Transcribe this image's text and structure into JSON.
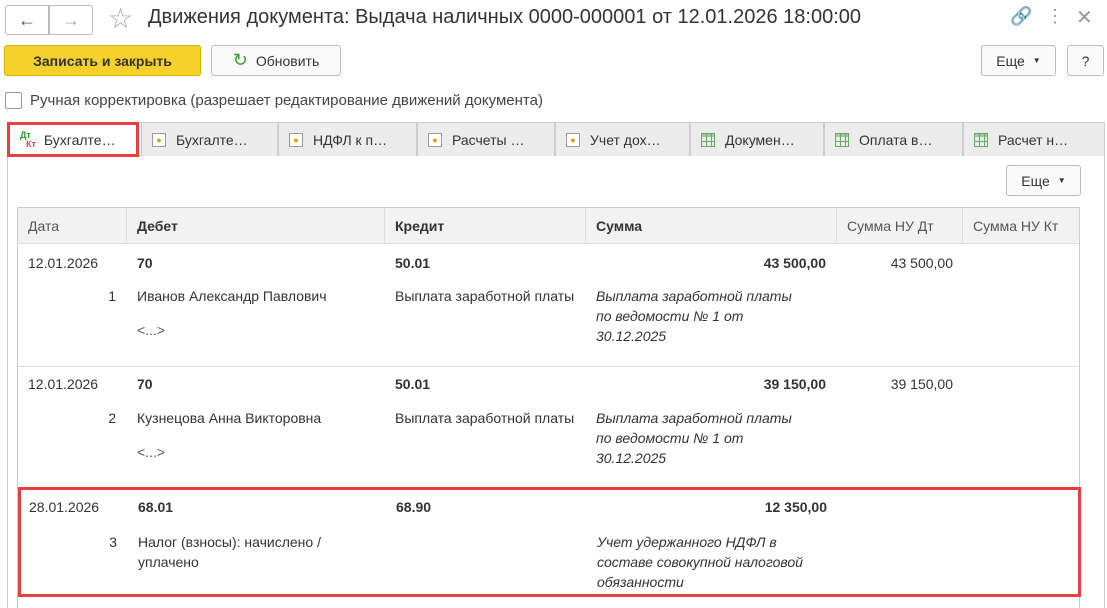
{
  "window": {
    "title": "Движения документа: Выдача наличных 0000-000001 от 12.01.2026 18:00:00"
  },
  "toolbar": {
    "save_close": "Записать и закрыть",
    "refresh": "Обновить",
    "more": "Еще",
    "help": "?"
  },
  "manual": {
    "label": "Ручная корректировка (разрешает редактирование движений документа)",
    "checked": false
  },
  "tabs": [
    {
      "label": "Бухгалте…",
      "icon": "dt-kt-icon",
      "active": true
    },
    {
      "label": "Бухгалте…",
      "icon": "register-coins-icon"
    },
    {
      "label": "НДФЛ к п…",
      "icon": "register-coins-icon"
    },
    {
      "label": "Расчеты …",
      "icon": "register-coins-icon"
    },
    {
      "label": "Учет дох…",
      "icon": "register-coins-icon"
    },
    {
      "label": "Докумен…",
      "icon": "table-grid-icon"
    },
    {
      "label": "Оплата в…",
      "icon": "table-grid-icon"
    },
    {
      "label": "Расчет н…",
      "icon": "table-grid-icon"
    }
  ],
  "panel": {
    "more": "Еще"
  },
  "table": {
    "headers": [
      "Дата",
      "Дебет",
      "Кредит",
      "Сумма",
      "Сумма НУ Дт",
      "Сумма НУ Кт"
    ],
    "rows": [
      {
        "date": "12.01.2026",
        "num": "1",
        "debit": "70",
        "debit_sub": "Иванов Александр Павлович",
        "debit_sub2": "<...>",
        "credit": "50.01",
        "credit_sub": "Выплата заработной платы",
        "sum": "43 500,00",
        "content": "Выплата заработной платы по ведомости № 1 от 30.12.2025",
        "nu_dt": "43 500,00"
      },
      {
        "date": "12.01.2026",
        "num": "2",
        "debit": "70",
        "debit_sub": "Кузнецова Анна Викторовна",
        "debit_sub2": "<...>",
        "credit": "50.01",
        "credit_sub": "Выплата заработной платы",
        "sum": "39 150,00",
        "content": "Выплата заработной платы по ведомости № 1 от 30.12.2025",
        "nu_dt": "39 150,00"
      },
      {
        "date": "28.01.2026",
        "num": "3",
        "debit": "68.01",
        "debit_sub": "Налог (взносы): начислено / уплачено",
        "credit": "68.90",
        "sum": "12 350,00",
        "content": "Учет удержанного НДФЛ в составе совокупной налоговой обязанности"
      }
    ]
  },
  "colors": {
    "accent": "#f5d22b",
    "highlight": "#e84040"
  }
}
